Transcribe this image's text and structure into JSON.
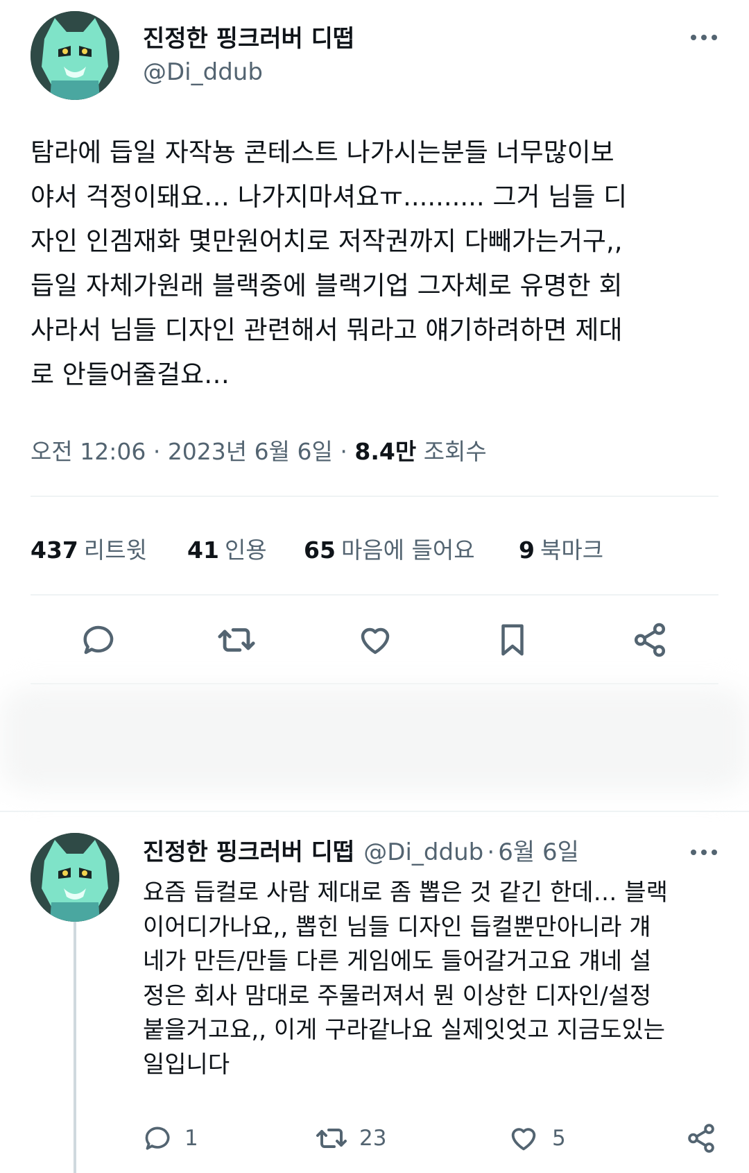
{
  "tweet": {
    "display_name": "진정한 핑크러버 디떱",
    "handle": "@Di_ddub",
    "text": "탐라에 듭일 자작뇽 콘테스트 나가시는분들 너무많이보\n야서 걱정이돼요… 나가지마셔요ㅠ.......... 그거 님들 디\n자인 인겜재화 몇만원어치로 저작권까지 다빼가는거구,,\n듭일 자체가원래 블랙중에 블랙기업 그자체로 유명한 회\n사라서 님들 디자인 관련해서 뭐라고 얘기하려하면 제대\n로 안들어줄걸요…",
    "time": "오전 12:06",
    "date": "2023년 6월 6일",
    "views_count": "8.4만",
    "views_label": "조회수",
    "separator": "·",
    "stats": {
      "retweets_count": "437",
      "retweets_label": "리트윗",
      "quotes_count": "41",
      "quotes_label": "인용",
      "likes_count": "65",
      "likes_label": "마음에 들어요",
      "bookmarks_count": "9",
      "bookmarks_label": "북마크"
    },
    "actions": [
      "reply-icon",
      "retweet-icon",
      "like-icon",
      "bookmark-icon",
      "share-icon"
    ]
  },
  "reply": {
    "display_name": "진정한 핑크러버 디떱",
    "handle": "@Di_ddub",
    "separator": "·",
    "date": "6월 6일",
    "text": "요즘 듭컬로 사람 제대로 좀 뽑은 것 같긴 한데… 블랙\n이어디가나요,, 뽑힌 님들 디자인 듭컬뿐만아니라 걔\n네가 만든/만들 다른 게임에도 들어갈거고요 걔네 설\n정은 회사 맘대로 주물러져서 뭔 이상한 디자인/설정\n붙을거고요,, 이게 구라같나요 실제잇엇고 지금도있는\n일입니다",
    "reply_count": "1",
    "retweet_count": "23",
    "like_count": "5"
  },
  "colors": {
    "text": "#0f1419",
    "secondary": "#536471",
    "divider": "#eff3f4",
    "avatar_accent": "#7fe3c8"
  }
}
